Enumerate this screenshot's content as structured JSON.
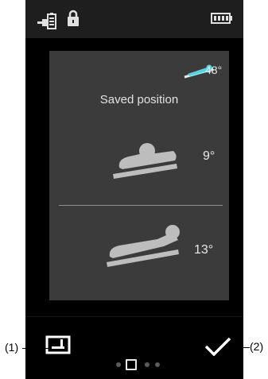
{
  "status_bar": {
    "icons": [
      "plug-battery-icon",
      "lock-icon",
      "battery-full-icon"
    ]
  },
  "panel": {
    "head_angle": "48°",
    "title": "Saved position",
    "positions": [
      {
        "icon": "bed-flat-icon",
        "angle": "9°"
      },
      {
        "icon": "bed-inclined-icon",
        "angle": "13°"
      }
    ]
  },
  "toolbar": {
    "save_icon": "save-icon",
    "confirm_icon": "checkmark-icon"
  },
  "pager": {
    "pages": 4,
    "active_index": 1
  },
  "callouts": {
    "left": "(1)",
    "right": "(2)"
  },
  "colors": {
    "background": "#000000",
    "panel": "#3b3b3b",
    "accent": "#4fd6e8",
    "text": "#e2e2e2"
  }
}
